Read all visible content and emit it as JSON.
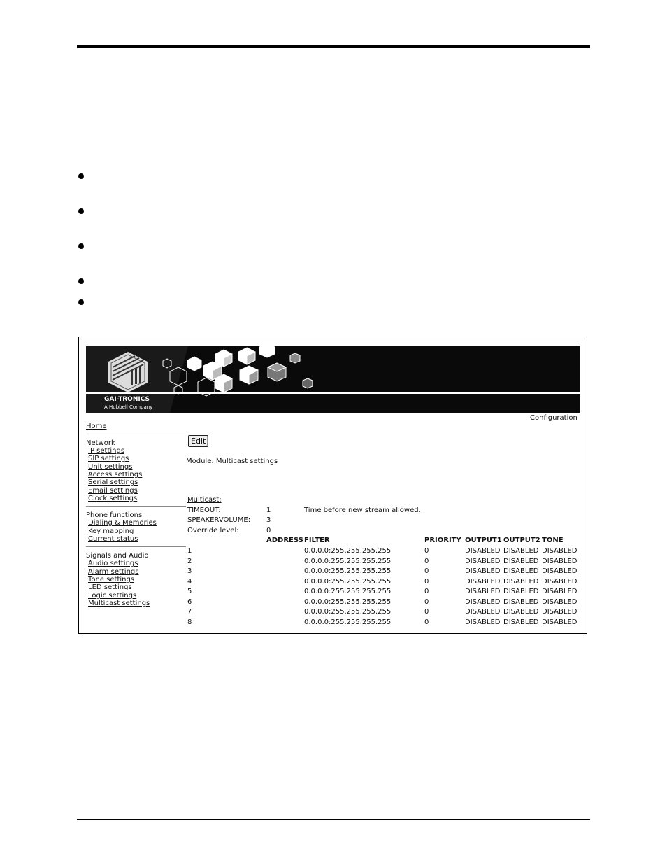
{
  "banner": {
    "brand": "GAI-TRONICS",
    "tagline": "A Hubbell Company"
  },
  "page": {
    "section_label": "Configuration",
    "edit_label": "Edit",
    "module_line": "Module: Multicast settings"
  },
  "sidebar": {
    "home": "Home",
    "groups": [
      {
        "title": "Network",
        "items": [
          "IP settings",
          "SIP settings",
          "Unit settings",
          "Access settings",
          "Serial settings",
          "Email settings",
          "Clock settings"
        ]
      },
      {
        "title": "Phone functions",
        "items": [
          "Dialing & Memories",
          "Key mapping",
          "Current status"
        ]
      },
      {
        "title": "Signals and Audio",
        "items": [
          "Audio settings",
          "Alarm settings",
          "Tone settings",
          "LED settings",
          "Logic settings",
          "Multicast settings"
        ]
      }
    ]
  },
  "multicast": {
    "heading": "Multicast:",
    "timeout_label": "TIMEOUT:",
    "timeout_value": "1",
    "timeout_note": "Time before new stream allowed.",
    "speaker_label": "SPEAKERVOLUME:",
    "speaker_value": "3",
    "override_label": "Override level:",
    "override_value": "0",
    "columns": [
      "ADDRESS",
      "FILTER",
      "PRIORITY",
      "OUTPUT1",
      "OUTPUT2",
      "TONE"
    ],
    "rows": [
      {
        "n": "1",
        "filter": "0.0.0.0:255.255.255.255",
        "priority": "0",
        "out1": "DISABLED",
        "out2": "DISABLED",
        "tone": "DISABLED"
      },
      {
        "n": "2",
        "filter": "0.0.0.0:255.255.255.255",
        "priority": "0",
        "out1": "DISABLED",
        "out2": "DISABLED",
        "tone": "DISABLED"
      },
      {
        "n": "3",
        "filter": "0.0.0.0:255.255.255.255",
        "priority": "0",
        "out1": "DISABLED",
        "out2": "DISABLED",
        "tone": "DISABLED"
      },
      {
        "n": "4",
        "filter": "0.0.0.0:255.255.255.255",
        "priority": "0",
        "out1": "DISABLED",
        "out2": "DISABLED",
        "tone": "DISABLED"
      },
      {
        "n": "5",
        "filter": "0.0.0.0:255.255.255.255",
        "priority": "0",
        "out1": "DISABLED",
        "out2": "DISABLED",
        "tone": "DISABLED"
      },
      {
        "n": "6",
        "filter": "0.0.0.0:255.255.255.255",
        "priority": "0",
        "out1": "DISABLED",
        "out2": "DISABLED",
        "tone": "DISABLED"
      },
      {
        "n": "7",
        "filter": "0.0.0.0:255.255.255.255",
        "priority": "0",
        "out1": "DISABLED",
        "out2": "DISABLED",
        "tone": "DISABLED"
      },
      {
        "n": "8",
        "filter": "0.0.0.0:255.255.255.255",
        "priority": "0",
        "out1": "DISABLED",
        "out2": "DISABLED",
        "tone": "DISABLED"
      }
    ]
  }
}
